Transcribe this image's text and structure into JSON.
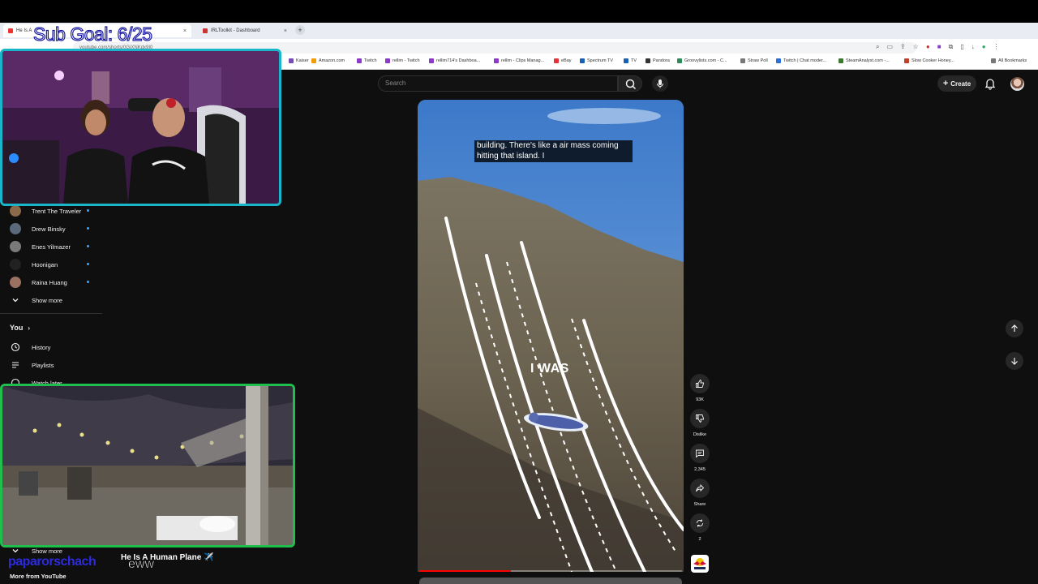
{
  "stream": {
    "sub_goal": "Sub Goal: 6/25",
    "handle": "paparorschach",
    "chat_word": "eww"
  },
  "browser": {
    "tabs": [
      {
        "label": "He Is A"
      },
      {
        "label": "IRLToolkit - Dashboard"
      }
    ],
    "url": "youtube.com/shorts/0GjXNKdx9I0",
    "bookmarks": [
      "Kaiser",
      "Amazon.com",
      "Twitch",
      "rellim - Twitch",
      "rellim714's Dashboa...",
      "rellim - Clips Manag...",
      "eBay",
      "Spectrum TV",
      "TV",
      "Pandora",
      "Groovylists.com - C...",
      "Straw Poll",
      "Twitch | Chat moder...",
      "SteamAnalyst.com -...",
      "Slow Cooker Honey..."
    ],
    "all_bookmarks": "All Bookmarks"
  },
  "youtube": {
    "search_placeholder": "Search",
    "create_label": "Create",
    "sidebar": {
      "subscriptions": [
        {
          "name": "Trent The Traveler",
          "color": "#8a6a4a"
        },
        {
          "name": "Drew Binsky",
          "color": "#5a6a7a"
        },
        {
          "name": "Enes Yilmazer",
          "color": "#7a7a7a"
        },
        {
          "name": "Hoonigan",
          "color": "#222222"
        },
        {
          "name": "Raina Huang",
          "color": "#9a7060"
        }
      ],
      "show_more": "Show more",
      "you_label": "You",
      "you_items": [
        "History",
        "Playlists",
        "Watch later"
      ],
      "show_more_2": "Show more",
      "more_from": "More from YouTube"
    },
    "short": {
      "caption": "building. There's like a air mass coming hitting that island. I",
      "overlay_text": "I WAS",
      "title": "He Is A Human Plane ✈️",
      "like_count": "93K",
      "dislike_label": "Dislike",
      "comment_count": "2,345",
      "share_label": "Share",
      "remix_count": "2",
      "progress": 0.35
    }
  }
}
